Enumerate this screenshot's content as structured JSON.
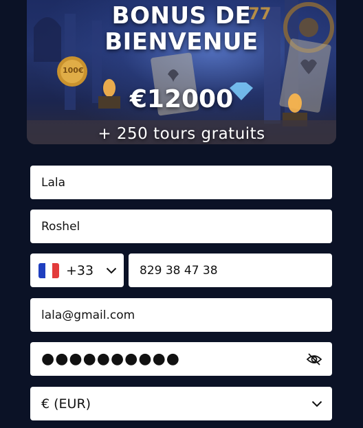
{
  "banner": {
    "title_line1": "BONUS DE",
    "title_line2": "BIENVENUE",
    "amount": "€12000",
    "spins": "+ 250 tours gratuits",
    "coin_text": "100€",
    "sevens_text": "77"
  },
  "form": {
    "first_name": "Lala",
    "last_name": "Roshel",
    "country_code": "+33",
    "country_flag": "france-flag-icon",
    "phone": "829 38 47 38",
    "email": "lala@gmail.com",
    "password_masked": "●●●●●●●●●●",
    "password_toggle_icon": "eye-off-icon",
    "currency": "€ (EUR)",
    "dropdown_icon": "chevron-down-icon"
  },
  "colors": {
    "page_background": "#0b1226",
    "field_background": "#ffffff",
    "flag_blue": "#1f3fbf",
    "flag_white": "#ffffff",
    "flag_red": "#e23b3b"
  }
}
